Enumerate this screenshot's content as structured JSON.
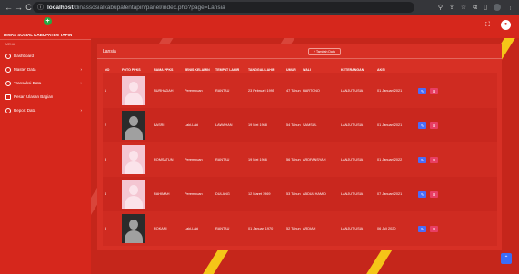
{
  "browser": {
    "back": "←",
    "forward": "→",
    "reload": "C",
    "info_icon": "ⓘ",
    "url_host": "localhost",
    "url_path": "/dinassosialkabupatentapin/panel/index.php?page=Lansia",
    "icons": [
      "search-icon",
      "share-icon",
      "star-icon",
      "extensions-icon",
      "sidebar-icon",
      "profile-icon",
      "menu-icon"
    ]
  },
  "sidebar": {
    "brand": "DINAS SOSIAL KABUPATEN TAPIN",
    "section": "MENU",
    "items": [
      {
        "label": "Dashboard",
        "caret": ""
      },
      {
        "label": "Master Data",
        "caret": "›"
      },
      {
        "label": "Transaksi Data",
        "caret": "›"
      },
      {
        "label": "Pesan Ulasan Bagian",
        "caret": ""
      },
      {
        "label": "Report Data",
        "caret": "›"
      }
    ]
  },
  "card": {
    "title": "Lansia",
    "add_button": "+ Tambah Data"
  },
  "table": {
    "headers": [
      "NO",
      "FOTO PPKS",
      "NAMA PPKS",
      "JENIS KELAMIN",
      "TEMPAT LAHIR",
      "TANGGAL LAHIR",
      "UMUR",
      "WALI",
      "KETERANGAN",
      "AKSI"
    ],
    "rows": [
      {
        "no": "1",
        "photo": "pink",
        "nama": "NURHADAH",
        "jk": "Perempuan",
        "tl": "RANTAU",
        "tgl": "23 Februari 1995",
        "umur": "47 Tahun",
        "wali": "HARTONO",
        "ket": "LANJUT USIA",
        "aksi": "01 Januari 2021"
      },
      {
        "no": "2",
        "photo": "dark",
        "nama": "BASRI",
        "jk": "Laki-Laki",
        "tl": "LAWAHAN",
        "tgl": "19 Mei 1968",
        "umur": "54 Tahun",
        "wali": "SAMSUL",
        "ket": "LANJUT USIA",
        "aksi": "01 Januari 2021"
      },
      {
        "no": "3",
        "photo": "pink",
        "nama": "ROMSATUN",
        "jk": "Perempuan",
        "tl": "RANTAU",
        "tgl": "19 Mei 1966",
        "umur": "56 Tahun",
        "wali": "ARDFANSYAH",
        "ket": "LANJUT USIA",
        "aksi": "01 Januari 2022"
      },
      {
        "no": "4",
        "photo": "pink",
        "nama": "RAHIMAH",
        "jk": "Perempuan",
        "tl": "DULANG",
        "tgl": "12 Maret 1969",
        "umur": "53 Tahun",
        "wali": "ABDUL HAMID",
        "ket": "LANJUT USIA",
        "aksi": "07 Januari 2021"
      },
      {
        "no": "5",
        "photo": "dark",
        "nama": "ROKANI",
        "jk": "Laki-Laki",
        "tl": "RANTAU",
        "tgl": "01 Januari 1970",
        "umur": "52 Tahun",
        "wali": "ARDIAH",
        "ket": "LANJUT USIA",
        "aksi": "06 Juli 2020"
      }
    ]
  },
  "colors": {
    "sidebar": "#d6271c",
    "card": "#d73025",
    "edit": "#4a6cf7",
    "delete": "#e83e63"
  }
}
